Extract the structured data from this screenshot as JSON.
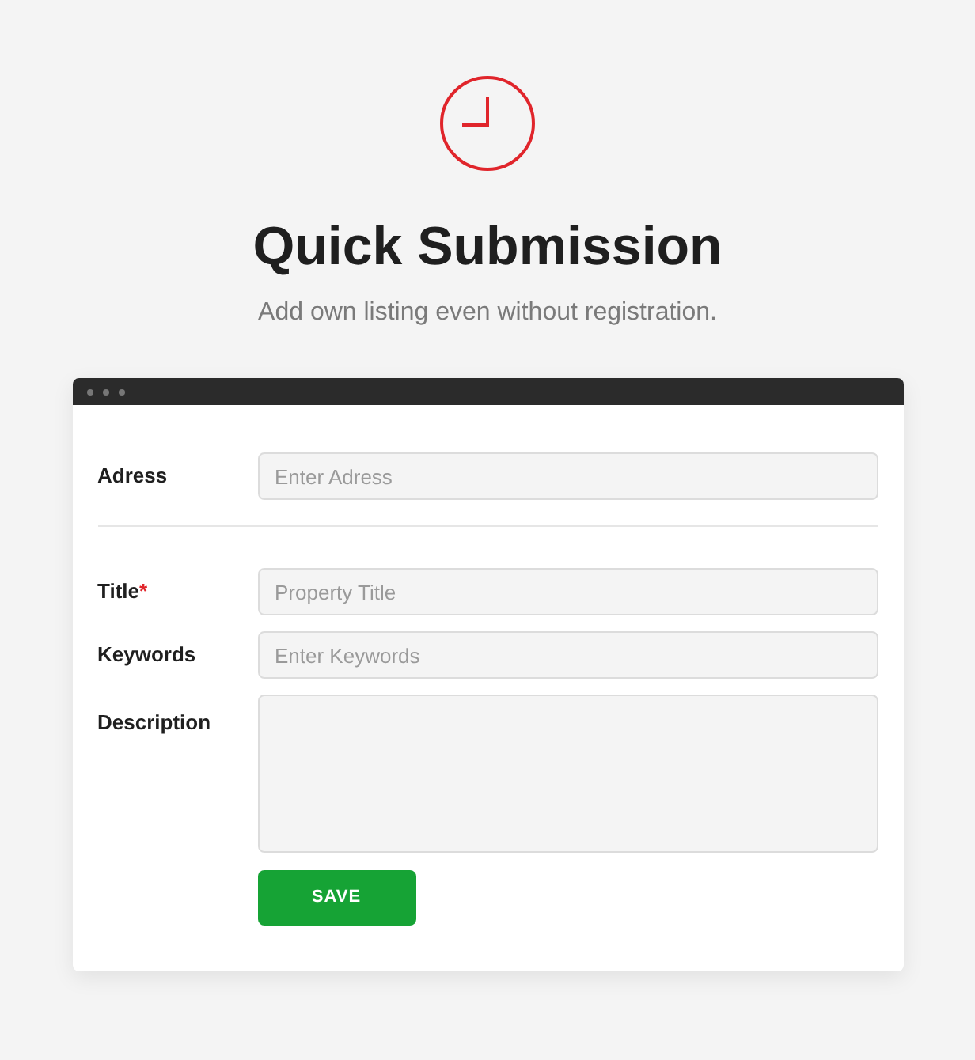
{
  "header": {
    "title": "Quick Submission",
    "subtitle": "Add own listing even without registration."
  },
  "form": {
    "sections": [
      [
        {
          "kind": "input",
          "label": "Adress",
          "placeholder": "Enter Adress"
        }
      ],
      [
        {
          "kind": "input",
          "label": "Title",
          "required_mark": "*",
          "placeholder": "Property Title"
        },
        {
          "kind": "input",
          "label": "Keywords",
          "placeholder": "Enter Keywords"
        },
        {
          "kind": "textarea",
          "label": "Description"
        }
      ]
    ],
    "submit": "SAVE"
  }
}
